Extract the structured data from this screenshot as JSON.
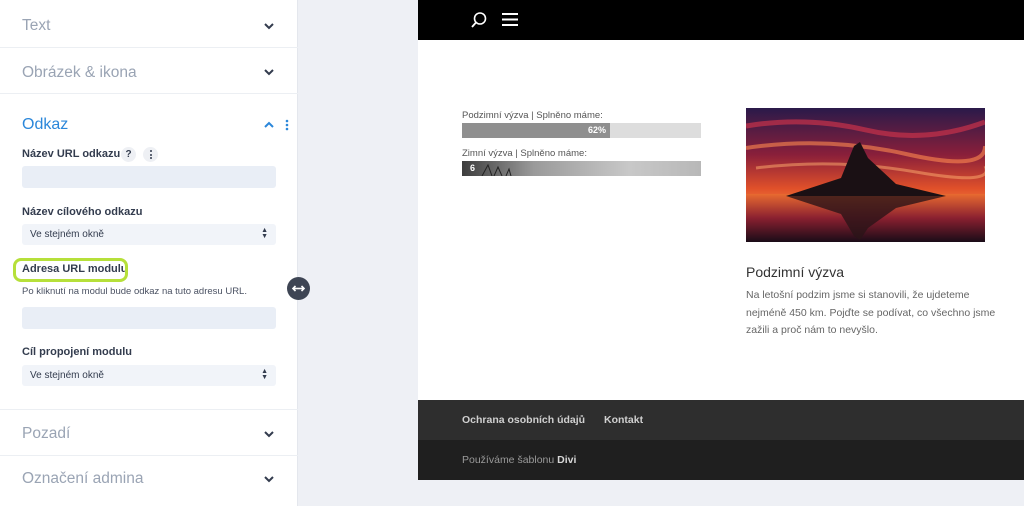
{
  "settings": {
    "sections": {
      "text": "Text",
      "image_icon": "Obrázek & ikona",
      "link": "Odkaz",
      "background": "Pozadí",
      "admin_label": "Označení admina"
    },
    "link_fields": {
      "url_name_label": "Název URL odkazu",
      "url_name_help": "?",
      "url_name_value": "",
      "target_name_label": "Název cílového odkazu",
      "target_name_value": "Ve stejném okně",
      "module_url_label": "Adresa URL modulu",
      "module_url_desc": "Po kliknutí na modul bude odkaz na tuto adresu URL.",
      "module_url_value": "",
      "module_target_label": "Cíl propojení modulu",
      "module_target_value": "Ve stejném okně"
    },
    "colors": {
      "active_section": "#2b87da",
      "highlight": "#b6e03a"
    }
  },
  "preview": {
    "bars": [
      {
        "label": "Podzimní výzva | Splněno máme:",
        "percent_text": "62%",
        "percent": 62
      },
      {
        "label": "Zimní výzva | Splněno máme:",
        "percent_text": "6",
        "percent": 6
      }
    ],
    "card": {
      "title": "Podzimní výzva",
      "text": "Na letošní podzim jsme si stanovili, že ujdeteme nejméně 450 km. Pojďte se podívat, co všechno jsme zažili a proč nám to nevyšlo."
    },
    "footer": {
      "privacy_link": "Ochrana osobních údajů",
      "contact_link": "Kontakt",
      "credit_prefix": "Používáme šablonu",
      "credit_theme": "Divi"
    }
  }
}
